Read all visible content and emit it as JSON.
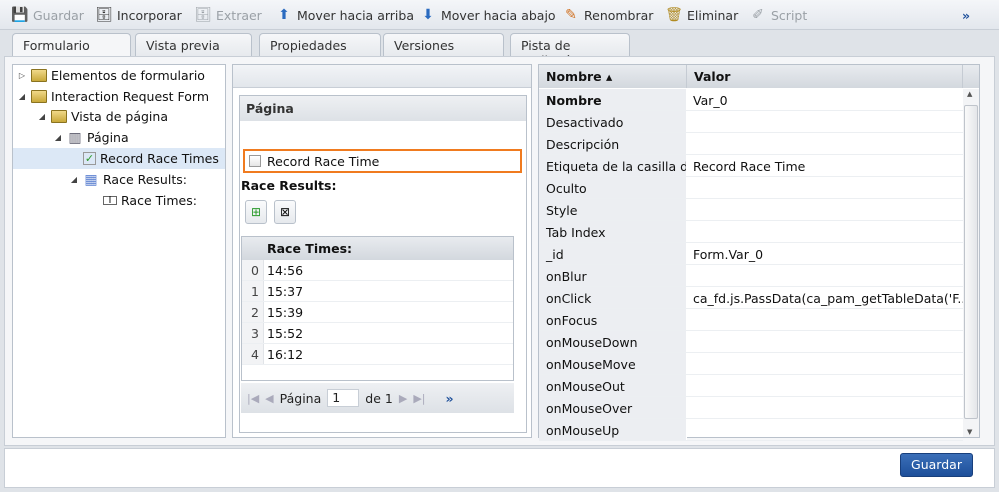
{
  "toolbar": {
    "guardar": "Guardar",
    "incorporar": "Incorporar",
    "extraer": "Extraer",
    "mover_arriba": "Mover hacia arriba",
    "mover_abajo": "Mover hacia abajo",
    "renombrar": "Renombrar",
    "eliminar": "Eliminar",
    "script": "Script",
    "more": "»"
  },
  "tabs": [
    "Formulario",
    "Vista previa",
    "Propiedades",
    "Versiones",
    "Pista de auditoría"
  ],
  "tree": [
    "Elementos de formulario",
    "Interaction Request Form",
    "Vista de página",
    "Página",
    "Record Race Times",
    "Race Results:",
    "Race Times:"
  ],
  "designer": {
    "page_title": "Página",
    "checkbox_label": "Record Race Time",
    "table_label": "Race Results:",
    "column": "Race Times:",
    "rows": [
      {
        "i": "0",
        "v": "14:56"
      },
      {
        "i": "1",
        "v": "15:37"
      },
      {
        "i": "2",
        "v": "15:39"
      },
      {
        "i": "3",
        "v": "15:52"
      },
      {
        "i": "4",
        "v": "16:12"
      }
    ],
    "pager": {
      "label": "Página",
      "value": "1",
      "of": "de 1",
      "more": "»"
    }
  },
  "props": {
    "col_name": "Nombre ▴",
    "col_value": "Valor",
    "rows": [
      {
        "k": "Nombre",
        "v": "Var_0"
      },
      {
        "k": "Desactivado",
        "v": ""
      },
      {
        "k": "Descripción",
        "v": ""
      },
      {
        "k": "Etiqueta de la casilla d...",
        "v": "Record Race Time"
      },
      {
        "k": "Oculto",
        "v": ""
      },
      {
        "k": "Style",
        "v": ""
      },
      {
        "k": "Tab Index",
        "v": ""
      },
      {
        "k": "_id",
        "v": "Form.Var_0"
      },
      {
        "k": "onBlur",
        "v": ""
      },
      {
        "k": "onClick",
        "v": "ca_fd.js.PassData(ca_pam_getTableData('F..."
      },
      {
        "k": "onFocus",
        "v": ""
      },
      {
        "k": "onMouseDown",
        "v": ""
      },
      {
        "k": "onMouseMove",
        "v": ""
      },
      {
        "k": "onMouseOut",
        "v": ""
      },
      {
        "k": "onMouseOver",
        "v": ""
      },
      {
        "k": "onMouseUp",
        "v": ""
      }
    ]
  },
  "footer": {
    "save": "Guardar"
  },
  "colors": {
    "accent": "#f07b1f",
    "button": "#2a5ea8"
  }
}
